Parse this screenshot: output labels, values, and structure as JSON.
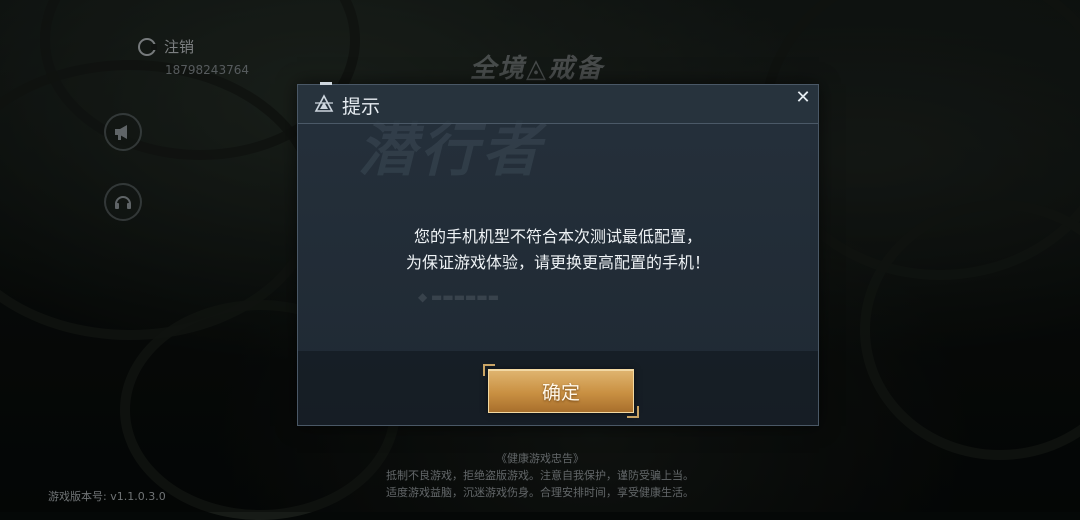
{
  "account": {
    "logout_label": "注销",
    "phone": "18798243764"
  },
  "side_buttons": [
    {
      "icon": "megaphone-icon"
    },
    {
      "icon": "headset-icon"
    }
  ],
  "background": {
    "logo_text": "全境◬戒备"
  },
  "dialog": {
    "title": "提示",
    "watermark": "潜行者",
    "message_line1": "您的手机机型不符合本次测试最低配置，",
    "message_line2": "为保证游戏体验，请更换更高配置的手机！",
    "confirm_label": "确定",
    "close_symbol": "✕"
  },
  "footer": {
    "version": "游戏版本号: v1.1.0.3.0",
    "health_title": "《健康游戏忠告》",
    "health_line1": "抵制不良游戏，拒绝盗版游戏。注意自我保护，谨防受骗上当。",
    "health_line2": "适度游戏益脑，沉迷游戏伤身。合理安排时间，享受健康生活。"
  },
  "colors": {
    "accent_gold": "#c99042",
    "dialog_bg": "#222c36",
    "text_primary": "#eef2f5"
  }
}
